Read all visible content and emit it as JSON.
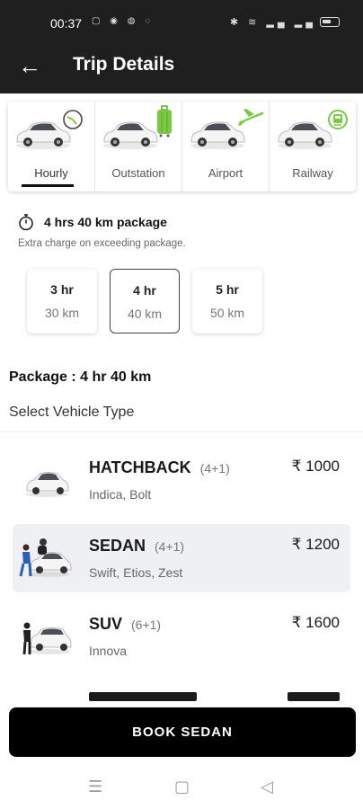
{
  "status_bar": {
    "time": "00:37"
  },
  "app_bar": {
    "title": "Trip Details"
  },
  "tabs": [
    {
      "label": "Hourly",
      "active": true,
      "badge": "clock-icon"
    },
    {
      "label": "Outstation",
      "active": false,
      "badge": "luggage-icon"
    },
    {
      "label": "Airport",
      "active": false,
      "badge": "airplane-icon"
    },
    {
      "label": "Railway",
      "active": false,
      "badge": "train-icon"
    }
  ],
  "package": {
    "heading": "4 hrs 40 km package",
    "note": "Extra charge on exceeding package.",
    "options": [
      {
        "hours": "3 hr",
        "km": "30 km",
        "selected": false
      },
      {
        "hours": "4 hr",
        "km": "40 km",
        "selected": true
      },
      {
        "hours": "5 hr",
        "km": "50 km",
        "selected": false
      }
    ],
    "summary": "Package : 4 hr 40 km"
  },
  "vehicle_section": {
    "title": "Select Vehicle Type"
  },
  "vehicles": [
    {
      "name": "HATCHBACK",
      "seats": "(4+1)",
      "models": "Indica, Bolt",
      "price": "₹ 1000",
      "selected": false
    },
    {
      "name": "SEDAN",
      "seats": "(4+1)",
      "models": "Swift, Etios, Zest",
      "price": "₹ 1200",
      "selected": true
    },
    {
      "name": "SUV",
      "seats": "(6+1)",
      "models": "Innova",
      "price": "₹ 1600",
      "selected": false
    }
  ],
  "book_button": {
    "label": "BOOK SEDAN"
  },
  "colors": {
    "app_bar": "#1f1f1f",
    "accent_green": "#7ac943",
    "selected_row": "#eef0f4",
    "button": "#000000"
  }
}
